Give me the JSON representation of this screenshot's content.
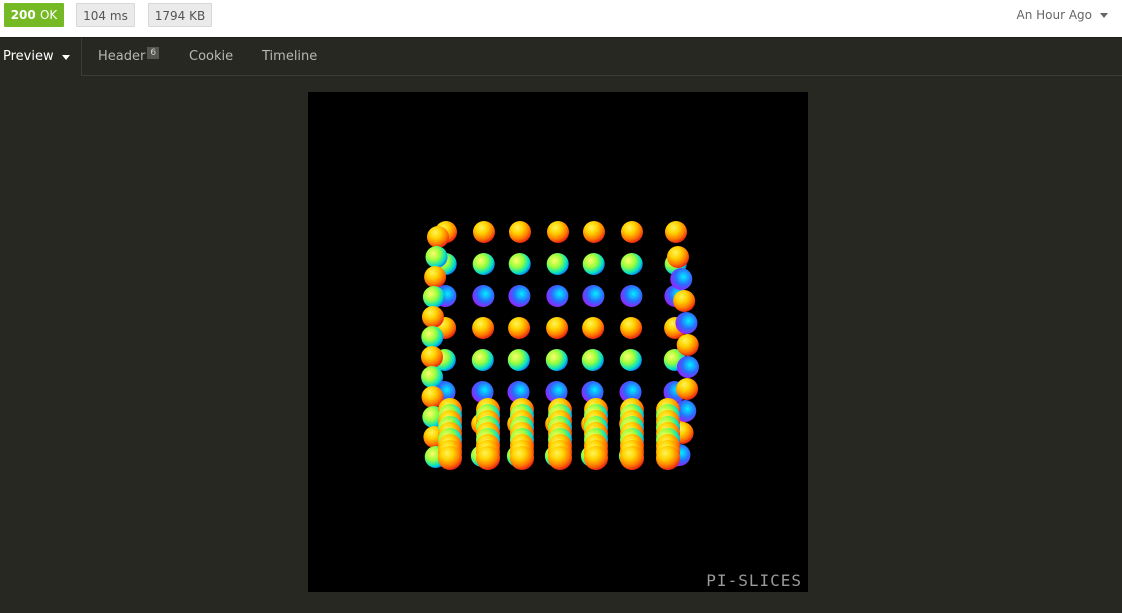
{
  "response": {
    "status_code": "200",
    "status_text": "OK",
    "time": "104 ms",
    "size": "1794 KB",
    "history_label": "An Hour Ago"
  },
  "tabs": {
    "preview": "Preview",
    "header": "Header",
    "header_count": "6",
    "cookie": "Cookie",
    "timeline": "Timeline"
  },
  "preview": {
    "watermark": "PI-SLICES",
    "background": "#000000"
  },
  "colors": {
    "status_ok": "#75ba24",
    "panel_bg": "#272822"
  },
  "icons": {
    "history_caret": "chevron-down-icon",
    "preview_caret": "chevron-down-icon"
  }
}
